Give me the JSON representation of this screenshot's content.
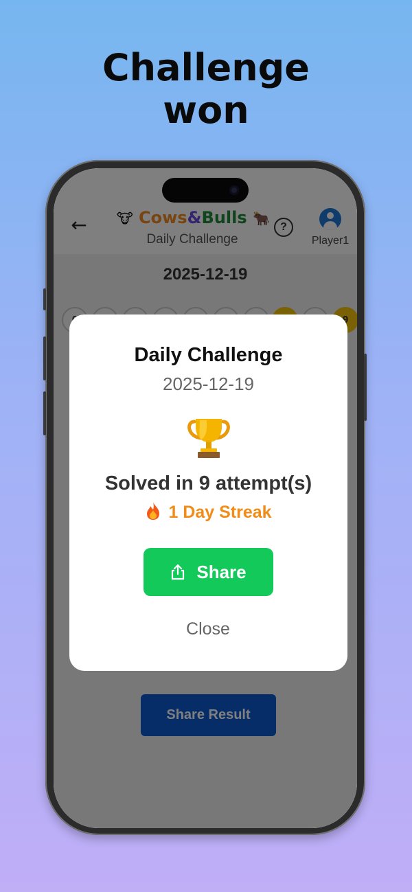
{
  "headline": {
    "line1": "Challenge",
    "line2": "won"
  },
  "app": {
    "back_icon": "arrow-left-icon",
    "logo": {
      "left_emoji": "🐮",
      "cows": "Cows",
      "amp": "&",
      "bulls": "Bulls",
      "right_emoji": "🐂"
    },
    "subtitle": "Daily Challenge",
    "help_icon": "question-circle-icon",
    "help_glyph": "?",
    "profile": {
      "icon": "user-avatar-icon",
      "name": "Player1"
    },
    "date": "2025-12-19",
    "digits": [
      {
        "label": "0",
        "highlighted": false
      },
      {
        "label": "",
        "highlighted": false
      },
      {
        "label": "",
        "highlighted": false
      },
      {
        "label": "",
        "highlighted": false
      },
      {
        "label": "",
        "highlighted": false
      },
      {
        "label": "",
        "highlighted": false
      },
      {
        "label": "",
        "highlighted": false
      },
      {
        "label": "",
        "highlighted": true
      },
      {
        "label": "",
        "highlighted": false
      },
      {
        "label": "9",
        "highlighted": true
      }
    ],
    "share_result_label": "Share Result"
  },
  "modal": {
    "title": "Daily Challenge",
    "date": "2025-12-19",
    "trophy_icon": "trophy-icon",
    "solved_text": "Solved in 9 attempt(s)",
    "streak": {
      "icon": "flame-icon",
      "text": "1 Day Streak"
    },
    "share_button": {
      "icon": "share-icon",
      "label": "Share"
    },
    "close_label": "Close"
  },
  "colors": {
    "background_top": "#76b6f0",
    "background_bottom": "#c0aef7",
    "share_green": "#13c95a",
    "streak_orange": "#f28c18",
    "share_result_blue": "#0d5bd0",
    "highlight_yellow": "#f4c20d"
  }
}
